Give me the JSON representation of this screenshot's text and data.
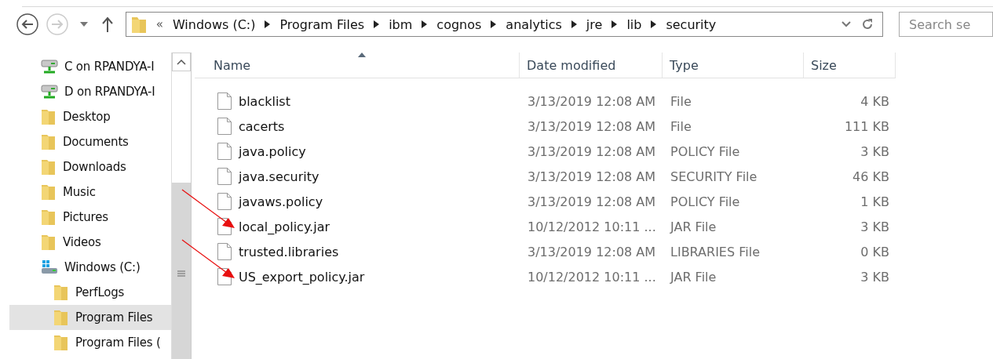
{
  "toolbar": {
    "path": [
      "Windows (C:)",
      "Program Files",
      "ibm",
      "cognos",
      "analytics",
      "jre",
      "lib",
      "security"
    ],
    "overflow": "«",
    "search": {
      "placeholder": "Search se"
    }
  },
  "sidebar": {
    "items": [
      {
        "label": "C on RPANDYA-I",
        "kind": "network-drive",
        "selected": false
      },
      {
        "label": "D on RPANDYA-I",
        "kind": "network-drive",
        "selected": false
      },
      {
        "label": "Desktop",
        "kind": "folder",
        "selected": false
      },
      {
        "label": "Documents",
        "kind": "folder",
        "selected": false
      },
      {
        "label": "Downloads",
        "kind": "folder",
        "selected": false
      },
      {
        "label": "Music",
        "kind": "folder",
        "selected": false
      },
      {
        "label": "Pictures",
        "kind": "folder",
        "selected": false
      },
      {
        "label": "Videos",
        "kind": "folder",
        "selected": false
      },
      {
        "label": "Windows (C:)",
        "kind": "drive",
        "selected": false,
        "children": [
          {
            "label": "PerfLogs",
            "kind": "folder",
            "selected": false
          },
          {
            "label": "Program Files",
            "kind": "folder",
            "selected": true
          },
          {
            "label": "Program Files (",
            "kind": "folder",
            "selected": false
          }
        ]
      }
    ]
  },
  "table": {
    "columns": [
      "Name",
      "Date modified",
      "Type",
      "Size"
    ],
    "rows": [
      {
        "name": "blacklist",
        "date": "3/13/2019 12:08 AM",
        "type": "File",
        "size": "4 KB",
        "marked": false
      },
      {
        "name": "cacerts",
        "date": "3/13/2019 12:08 AM",
        "type": "File",
        "size": "111 KB",
        "marked": false
      },
      {
        "name": "java.policy",
        "date": "3/13/2019 12:08 AM",
        "type": "POLICY File",
        "size": "3 KB",
        "marked": false
      },
      {
        "name": "java.security",
        "date": "3/13/2019 12:08 AM",
        "type": "SECURITY File",
        "size": "46 KB",
        "marked": false
      },
      {
        "name": "javaws.policy",
        "date": "3/13/2019 12:08 AM",
        "type": "POLICY File",
        "size": "1 KB",
        "marked": false
      },
      {
        "name": "local_policy.jar",
        "date": "10/12/2012 10:11 ...",
        "type": "JAR File",
        "size": "3 KB",
        "marked": true
      },
      {
        "name": "trusted.libraries",
        "date": "3/13/2019 12:08 AM",
        "type": "LIBRARIES File",
        "size": "0 KB",
        "marked": false
      },
      {
        "name": "US_export_policy.jar",
        "date": "10/12/2012 10:11 ...",
        "type": "JAR File",
        "size": "3 KB",
        "marked": true
      }
    ]
  }
}
